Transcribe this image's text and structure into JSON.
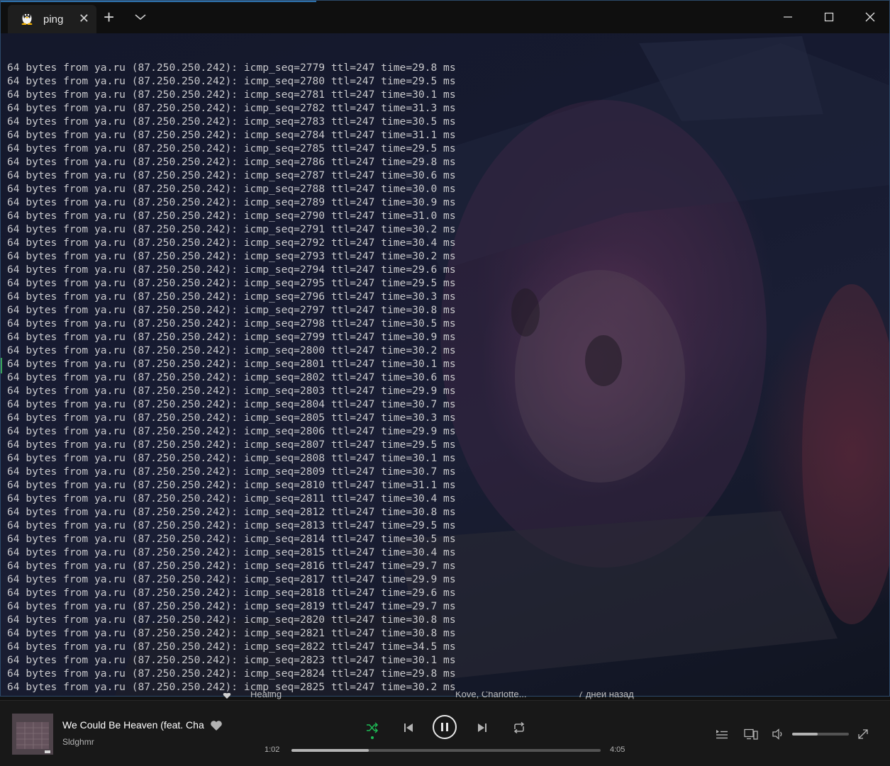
{
  "window": {
    "tab_title": "ping",
    "tab_close_glyph": "✕",
    "new_tab_glyph": "+",
    "icons": [
      "tux-icon",
      "plus-icon",
      "chevron-down-icon",
      "minimize-icon",
      "maximize-icon",
      "close-icon"
    ]
  },
  "terminal": {
    "lines": [
      "64 bytes from ya.ru (87.250.250.242): icmp_seq=2779 ttl=247 time=29.8 ms",
      "64 bytes from ya.ru (87.250.250.242): icmp_seq=2780 ttl=247 time=29.5 ms",
      "64 bytes from ya.ru (87.250.250.242): icmp_seq=2781 ttl=247 time=30.1 ms",
      "64 bytes from ya.ru (87.250.250.242): icmp_seq=2782 ttl=247 time=31.3 ms",
      "64 bytes from ya.ru (87.250.250.242): icmp_seq=2783 ttl=247 time=30.5 ms",
      "64 bytes from ya.ru (87.250.250.242): icmp_seq=2784 ttl=247 time=31.1 ms",
      "64 bytes from ya.ru (87.250.250.242): icmp_seq=2785 ttl=247 time=29.5 ms",
      "64 bytes from ya.ru (87.250.250.242): icmp_seq=2786 ttl=247 time=29.8 ms",
      "64 bytes from ya.ru (87.250.250.242): icmp_seq=2787 ttl=247 time=30.6 ms",
      "64 bytes from ya.ru (87.250.250.242): icmp_seq=2788 ttl=247 time=30.0 ms",
      "64 bytes from ya.ru (87.250.250.242): icmp_seq=2789 ttl=247 time=30.9 ms",
      "64 bytes from ya.ru (87.250.250.242): icmp_seq=2790 ttl=247 time=31.0 ms",
      "64 bytes from ya.ru (87.250.250.242): icmp_seq=2791 ttl=247 time=30.2 ms",
      "64 bytes from ya.ru (87.250.250.242): icmp_seq=2792 ttl=247 time=30.4 ms",
      "64 bytes from ya.ru (87.250.250.242): icmp_seq=2793 ttl=247 time=30.2 ms",
      "64 bytes from ya.ru (87.250.250.242): icmp_seq=2794 ttl=247 time=29.6 ms",
      "64 bytes from ya.ru (87.250.250.242): icmp_seq=2795 ttl=247 time=29.5 ms",
      "64 bytes from ya.ru (87.250.250.242): icmp_seq=2796 ttl=247 time=30.3 ms",
      "64 bytes from ya.ru (87.250.250.242): icmp_seq=2797 ttl=247 time=30.8 ms",
      "64 bytes from ya.ru (87.250.250.242): icmp_seq=2798 ttl=247 time=30.5 ms",
      "64 bytes from ya.ru (87.250.250.242): icmp_seq=2799 ttl=247 time=30.9 ms",
      "64 bytes from ya.ru (87.250.250.242): icmp_seq=2800 ttl=247 time=30.2 ms",
      "64 bytes from ya.ru (87.250.250.242): icmp_seq=2801 ttl=247 time=30.1 ms",
      "64 bytes from ya.ru (87.250.250.242): icmp_seq=2802 ttl=247 time=30.6 ms",
      "64 bytes from ya.ru (87.250.250.242): icmp_seq=2803 ttl=247 time=29.9 ms",
      "64 bytes from ya.ru (87.250.250.242): icmp_seq=2804 ttl=247 time=30.7 ms",
      "64 bytes from ya.ru (87.250.250.242): icmp_seq=2805 ttl=247 time=30.3 ms",
      "64 bytes from ya.ru (87.250.250.242): icmp_seq=2806 ttl=247 time=29.9 ms",
      "64 bytes from ya.ru (87.250.250.242): icmp_seq=2807 ttl=247 time=29.5 ms",
      "64 bytes from ya.ru (87.250.250.242): icmp_seq=2808 ttl=247 time=30.1 ms",
      "64 bytes from ya.ru (87.250.250.242): icmp_seq=2809 ttl=247 time=30.7 ms",
      "64 bytes from ya.ru (87.250.250.242): icmp_seq=2810 ttl=247 time=31.1 ms",
      "64 bytes from ya.ru (87.250.250.242): icmp_seq=2811 ttl=247 time=30.4 ms",
      "64 bytes from ya.ru (87.250.250.242): icmp_seq=2812 ttl=247 time=30.8 ms",
      "64 bytes from ya.ru (87.250.250.242): icmp_seq=2813 ttl=247 time=29.5 ms",
      "64 bytes from ya.ru (87.250.250.242): icmp_seq=2814 ttl=247 time=30.5 ms",
      "64 bytes from ya.ru (87.250.250.242): icmp_seq=2815 ttl=247 time=30.4 ms",
      "64 bytes from ya.ru (87.250.250.242): icmp_seq=2816 ttl=247 time=29.7 ms",
      "64 bytes from ya.ru (87.250.250.242): icmp_seq=2817 ttl=247 time=29.9 ms",
      "64 bytes from ya.ru (87.250.250.242): icmp_seq=2818 ttl=247 time=29.6 ms",
      "64 bytes from ya.ru (87.250.250.242): icmp_seq=2819 ttl=247 time=29.7 ms",
      "64 bytes from ya.ru (87.250.250.242): icmp_seq=2820 ttl=247 time=30.8 ms",
      "64 bytes from ya.ru (87.250.250.242): icmp_seq=2821 ttl=247 time=30.8 ms",
      "64 bytes from ya.ru (87.250.250.242): icmp_seq=2822 ttl=247 time=34.5 ms",
      "64 bytes from ya.ru (87.250.250.242): icmp_seq=2823 ttl=247 time=30.1 ms",
      "64 bytes from ya.ru (87.250.250.242): icmp_seq=2824 ttl=247 time=29.8 ms",
      "64 bytes from ya.ru (87.250.250.242): icmp_seq=2825 ttl=247 time=30.2 ms"
    ],
    "cursor": "_",
    "text_color": "#c9c9cc"
  },
  "background_list": {
    "title": "Healing",
    "artist": "Kove, Charlotte...",
    "added": "7 дней назад"
  },
  "player": {
    "track_title": "We Could Be Heaven (feat. Charlotte Haining)",
    "artist": "Sldghmr",
    "elapsed": "1:02",
    "total": "4:05",
    "progress_fraction": 0.25,
    "volume_fraction": 0.45,
    "accent_color": "#1db954",
    "icons": [
      "heart-icon",
      "shuffle-icon",
      "previous-icon",
      "pause-icon",
      "next-icon",
      "repeat-icon",
      "queue-icon",
      "devices-icon",
      "volume-icon",
      "fullscreen-icon"
    ]
  }
}
